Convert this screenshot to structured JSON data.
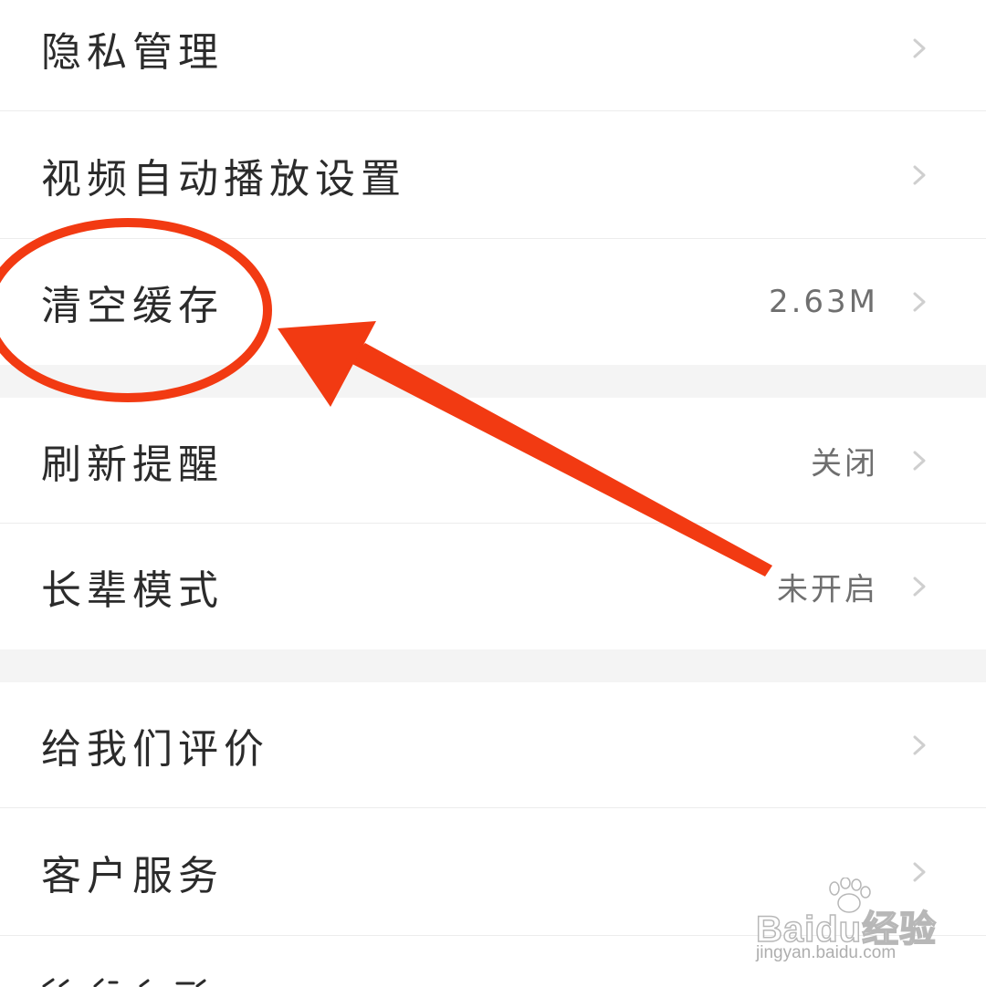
{
  "settings": {
    "items": [
      {
        "label": "隐私管理",
        "value": ""
      },
      {
        "label": "视频自动播放设置",
        "value": ""
      },
      {
        "label": "清空缓存",
        "value": "2.63M"
      },
      {
        "label": "刷新提醒",
        "value": "关闭"
      },
      {
        "label": "长辈模式",
        "value": "未开启"
      },
      {
        "label": "给我们评价",
        "value": ""
      },
      {
        "label": "客户服务",
        "value": ""
      },
      {
        "label": "",
        "value": ""
      }
    ]
  },
  "icons": {
    "chevron": "chevron-right-icon"
  },
  "annotation": {
    "color": "#f23a12",
    "shapes": [
      "highlight-ellipse",
      "pointer-arrow"
    ]
  },
  "watermark": {
    "brand": "Baidu经验",
    "url": "jingyan.baidu.com"
  },
  "colors": {
    "background": "#ffffff",
    "section_gap": "#f4f4f4",
    "divider": "#ececec",
    "label_text": "#2b2b2b",
    "value_text": "#6f6f6f",
    "chevron": "#cfcfcf"
  }
}
